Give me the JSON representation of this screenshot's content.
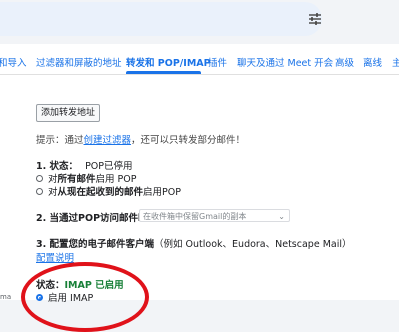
{
  "header": {
    "tune_icon": "tune-icon"
  },
  "tabs": [
    {
      "label": "和导入"
    },
    {
      "label": "过滤器和屏蔽的地址"
    },
    {
      "label": "转发和 POP/IMAP",
      "active": true
    },
    {
      "label": "插件"
    },
    {
      "label": "聊天及通过 Meet 开会"
    },
    {
      "label": "高级"
    },
    {
      "label": "离线"
    },
    {
      "label": "主"
    }
  ],
  "forwarding": {
    "add_button": "添加转发地址",
    "tip_prefix": "提示：通过",
    "tip_link": "创建过滤器",
    "tip_suffix": "，还可以只转发部分邮件！"
  },
  "pop": {
    "status_label": "1. 状态：",
    "status_value": "POP已停用",
    "option_all_pre": "对",
    "option_all_bold": "所有邮件",
    "option_all_post": "启用 POP",
    "option_now_pre": "对",
    "option_now_bold": "从现在起收到的邮件",
    "option_now_post": "启用POP",
    "access_label": "2. 当通过POP访问邮件时",
    "access_select": "在收件箱中保留Gmail的副本",
    "client_label": "3. 配置您的电子邮件客户端",
    "client_hint": "（例如 Outlook、Eudora、Netscape Mail）",
    "config_link": "配置说明"
  },
  "imap": {
    "status_label": "状态：",
    "status_value": "IMAP 已启用",
    "option_enable": "启用 IMAP"
  },
  "left_edge_text": "ma"
}
